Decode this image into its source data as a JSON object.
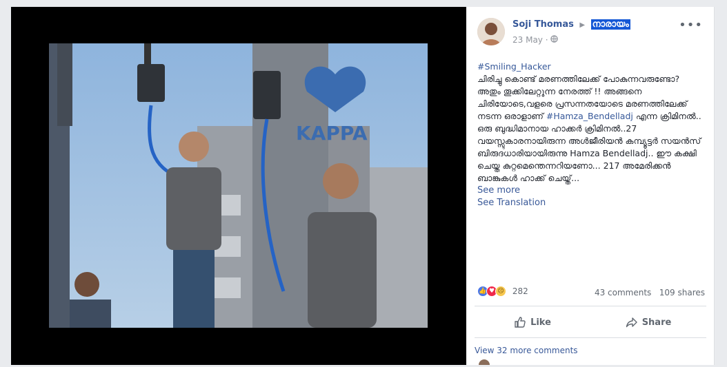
{
  "post": {
    "author": "Soji Thomas",
    "group_name": "നാരായം",
    "date": "23 May",
    "hashtag": "#Smiling_Hacker",
    "text_line1": "ചിരിച്ചു കൊണ്ട് മരണത്തിലേക്ക് പോകുന്നവരുണ്ടോ? അതും തൂക്കിലേറ്റുന്ന നേരത്ത് !! അങ്ങനെ ചിരിയോടെ,വളരെ പ്രസന്നതയോടെ മരണത്തിലേക്ക് നടന്ന ഒരാളാണ്",
    "hashtag2": "#Hamza_Bendelladj",
    "text_line2": "എന്ന ക്രിമിനൽ.. ഒരു ബുദ്ധിമാനായ ഹാക്കർ ക്രിമിനൽ..27 വയസ്സുകാരനായിരുന്ന അൾജീരിയൻ കമ്പ്യൂട്ടർ സയൻസ് ബിരുദധാരിയായിരുന്നു Hamza Bendelladj.. ഈ കക്ഷി ചെയ്ത കുറ്റമെന്തെന്നറിയണോ... 217 അമേരിക്കൻ ബാങ്കുകൾ ഹാക്ക് ചെയ്ത്...",
    "see_more": "See more",
    "see_translation": "See Translation"
  },
  "photo": {
    "watermark": "KAPPA"
  },
  "reactions": {
    "count": "282",
    "comments": "43 comments",
    "shares": "109 shares"
  },
  "actions": {
    "like": "Like",
    "share": "Share"
  },
  "comments": {
    "view_more": "View 32 more comments"
  },
  "icons": {
    "more": "more-options-icon",
    "privacy": "globe-icon",
    "arrow": "triangle-right-icon",
    "like": "thumbs-up-icon",
    "share": "share-arrow-icon"
  },
  "colors": {
    "link": "#385898",
    "group_highlight": "#1558d6",
    "stage": "#000000",
    "watermark": "#3b6cb0"
  }
}
